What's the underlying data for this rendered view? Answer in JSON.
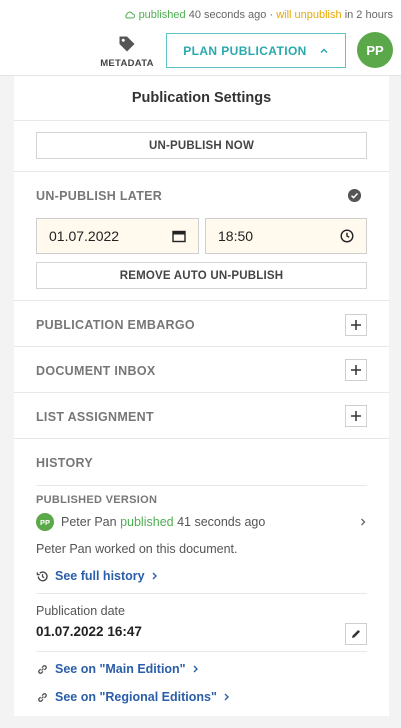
{
  "status": {
    "published_word": "published",
    "published_ago": "40 seconds ago",
    "separator": "·",
    "unpublish_word": "will unpublish",
    "unpublish_in": "in 2 hours"
  },
  "toolbar": {
    "metadata_label": "METADATA",
    "plan_label": "PLAN PUBLICATION",
    "user_initials": "PP"
  },
  "panel": {
    "title": "Publication Settings",
    "unpublish_now_label": "UN-PUBLISH NOW",
    "unpublish_later": {
      "label": "UN-PUBLISH LATER",
      "date_value": "01.07.2022",
      "time_value": "18:50",
      "remove_label": "REMOVE AUTO UN-PUBLISH"
    },
    "sections": {
      "embargo": "PUBLICATION EMBARGO",
      "inbox": "DOCUMENT INBOX",
      "list": "LIST ASSIGNMENT"
    },
    "history": {
      "label": "HISTORY",
      "published_version_label": "PUBLISHED VERSION",
      "user_initials": "PP",
      "user_name": "Peter Pan",
      "action": "published",
      "ago": "41 seconds ago",
      "worked_on": "Peter Pan worked on this document.",
      "full_history_link": "See full history"
    },
    "publication_date_label": "Publication date",
    "publication_date_value": "01.07.2022 16:47",
    "links": {
      "main_edition": "See on \"Main Edition\"",
      "regional_editions": "See on \"Regional Editions\""
    }
  },
  "colors": {
    "accent": "#2aa9ae",
    "published": "#4caf50",
    "unpublish": "#e6a800",
    "avatar": "#5aa84a",
    "link": "#2b5ea8"
  }
}
